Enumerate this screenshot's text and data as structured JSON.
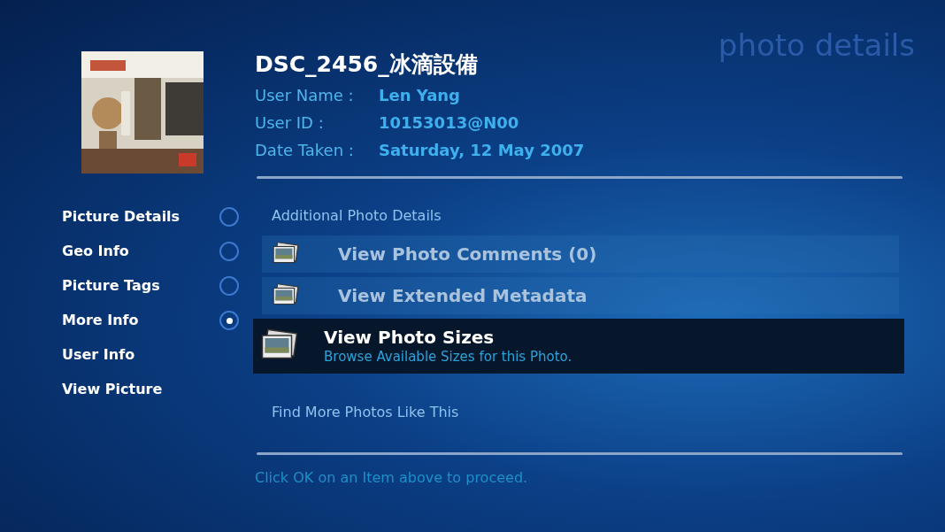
{
  "screen_title": "photo details",
  "photo": {
    "title": "DSC_2456_冰滴設備"
  },
  "fields": [
    {
      "label": "User Name :",
      "value": "Len Yang"
    },
    {
      "label": "User ID :",
      "value": "10153013@N00"
    },
    {
      "label": "Date Taken :",
      "value": "Saturday, 12 May 2007"
    }
  ],
  "sidebar": {
    "items": [
      {
        "label": "Picture Details",
        "kind": "radio",
        "selected": false
      },
      {
        "label": "Geo Info",
        "kind": "radio",
        "selected": false
      },
      {
        "label": "Picture Tags",
        "kind": "radio",
        "selected": false
      },
      {
        "label": "More Info",
        "kind": "radio",
        "selected": true
      },
      {
        "label": "User Info",
        "kind": "link"
      },
      {
        "label": "View Picture",
        "kind": "link"
      }
    ]
  },
  "section_heading": "Additional Photo Details",
  "actions": [
    {
      "label": "View Photo Comments (0)",
      "selected": false
    },
    {
      "label": "View Extended Metadata",
      "selected": false
    },
    {
      "label": "View Photo Sizes",
      "description": "Browse Available Sizes for this Photo.",
      "selected": true
    }
  ],
  "more_link": "Find More Photos Like This",
  "hint": "Click OK on an Item above to proceed."
}
